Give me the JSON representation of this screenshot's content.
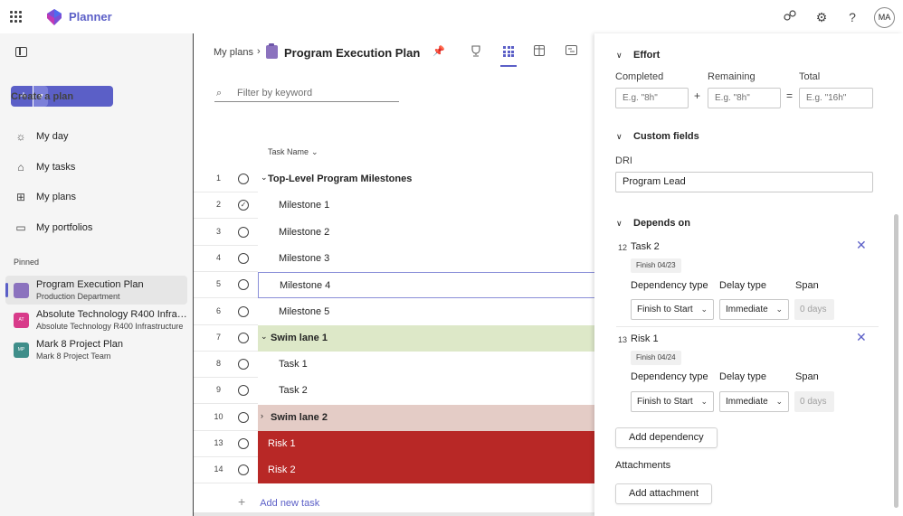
{
  "app": {
    "name": "Planner",
    "colors": {
      "accent": "#5b5fc7"
    }
  },
  "topbar": {
    "avatar_initials": "MA",
    "icons": [
      "share-icon",
      "gear-icon",
      "help-icon"
    ]
  },
  "sidebar": {
    "create_label": "Create a plan",
    "nav": [
      {
        "label": "My day",
        "icon": "sun-icon"
      },
      {
        "label": "My tasks",
        "icon": "tasks-icon"
      },
      {
        "label": "My plans",
        "icon": "plans-icon"
      },
      {
        "label": "My portfolios",
        "icon": "folder-icon"
      }
    ],
    "pinned_label": "Pinned",
    "pinned": [
      {
        "title": "Program Execution Plan",
        "subtitle": "Production Department",
        "icon_color": "#8b72be",
        "active": true
      },
      {
        "title": "Absolute Technology R400 Infrastructure",
        "subtitle": "Absolute Technology R400 Infrastructure",
        "icon_text": "AT",
        "icon_color": "#d83b8a"
      },
      {
        "title": "Mark 8 Project Plan",
        "subtitle": "Mark 8 Project Team",
        "icon_text": "MP",
        "icon_color": "#3f8e8a"
      }
    ]
  },
  "main": {
    "breadcrumb_root": "My plans",
    "plan_title": "Program Execution Plan",
    "filter_placeholder": "Filter by keyword",
    "column_header": "Task Name",
    "add_task_label": "Add new task",
    "rows": [
      {
        "num": "1",
        "name": "Top-Level Program Milestones",
        "bold": true,
        "caret": "expanded",
        "indent": 0,
        "done": false,
        "bg": "#ffffff",
        "text": "#242424"
      },
      {
        "num": "2",
        "name": "Milestone 1",
        "bold": false,
        "indent": 1,
        "done": true,
        "bg": "#ffffff",
        "text": "#242424"
      },
      {
        "num": "3",
        "name": "Milestone 2",
        "bold": false,
        "indent": 1,
        "done": false,
        "bg": "#ffffff",
        "text": "#242424"
      },
      {
        "num": "4",
        "name": "Milestone 3",
        "bold": false,
        "indent": 1,
        "done": false,
        "bg": "#ffffff",
        "text": "#242424"
      },
      {
        "num": "5",
        "name": "Milestone 4",
        "bold": false,
        "indent": 1,
        "done": false,
        "bg": "#ffffff",
        "text": "#242424",
        "selected": true
      },
      {
        "num": "6",
        "name": "Milestone 5",
        "bold": false,
        "indent": 1,
        "done": false,
        "bg": "#ffffff",
        "text": "#242424"
      },
      {
        "num": "7",
        "name": "Swim lane 1",
        "bold": true,
        "caret": "expanded",
        "indent": 0,
        "done": false,
        "bg": "#dde8c8",
        "text": "#242424"
      },
      {
        "num": "8",
        "name": "Task 1",
        "bold": false,
        "indent": 1,
        "done": false,
        "bg": "#ffffff",
        "text": "#242424"
      },
      {
        "num": "9",
        "name": "Task 2",
        "bold": false,
        "indent": 1,
        "done": false,
        "bg": "#ffffff",
        "text": "#242424"
      },
      {
        "num": "10",
        "name": "Swim lane 2",
        "bold": true,
        "caret": "collapsed",
        "indent": 0,
        "done": false,
        "bg": "#e4ccc6",
        "text": "#242424"
      },
      {
        "num": "13",
        "name": "Risk 1",
        "bold": false,
        "indent": 0,
        "done": false,
        "bg": "#b82826",
        "text": "#ffffff"
      },
      {
        "num": "14",
        "name": "Risk 2",
        "bold": false,
        "indent": 0,
        "done": false,
        "bg": "#b82826",
        "text": "#ffffff"
      }
    ]
  },
  "panel": {
    "effort": {
      "heading": "Effort",
      "completed_label": "Completed",
      "completed_placeholder": "E.g. \"8h\"",
      "remaining_label": "Remaining",
      "remaining_placeholder": "E.g. \"8h\"",
      "total_label": "Total",
      "total_placeholder": "E.g. \"16h\"",
      "plus": "+",
      "equals": "="
    },
    "custom_fields": {
      "heading": "Custom fields",
      "field_label": "DRI",
      "field_value": "Program Lead"
    },
    "depends_on": {
      "heading": "Depends on",
      "col_dependency": "Dependency type",
      "col_delay": "Delay type",
      "col_span": "Span",
      "items": [
        {
          "num": "12",
          "name": "Task 2",
          "badge": "Finish 04/23",
          "dependency": "Finish to Start",
          "delay": "Immediate",
          "span": "0 days"
        },
        {
          "num": "13",
          "name": "Risk 1",
          "badge": "Finish 04/24",
          "dependency": "Finish to Start",
          "delay": "Immediate",
          "span": "0 days"
        }
      ],
      "add_button": "Add dependency"
    },
    "attachments": {
      "heading": "Attachments",
      "add_button": "Add attachment"
    }
  }
}
